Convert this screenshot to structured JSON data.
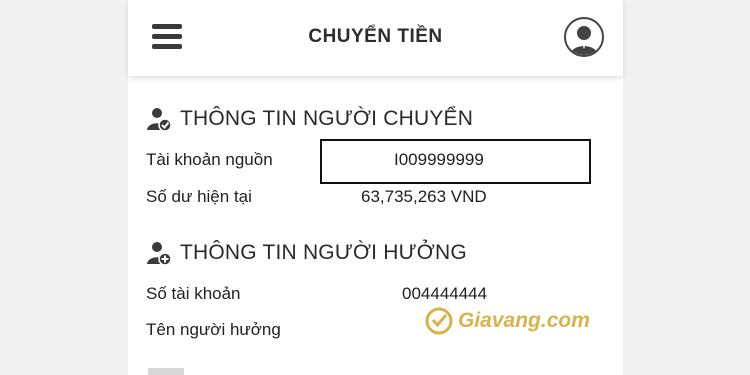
{
  "header": {
    "title": "CHUYỂN TIỀN",
    "menu_icon": "hamburger-menu-icon",
    "avatar_icon": "user-avatar-icon"
  },
  "sender_section": {
    "heading": "THÔNG TIN NGƯỜI CHUYỂN",
    "icon": "user-check-icon",
    "source_account_label": "Tài khoản nguồn",
    "source_account_value": "I009999999",
    "balance_label": "Số dư hiện tại",
    "balance_value": "63,735,263 VND"
  },
  "receiver_section": {
    "heading": "THÔNG TIN NGƯỜI HƯỞNG",
    "icon": "user-add-icon",
    "account_number_label": "Số tài khoản",
    "account_number_value": "004444444",
    "beneficiary_name_label": "Tên người hưởng",
    "beneficiary_name_value": ""
  },
  "watermark": {
    "text": "Giavang.com",
    "icon": "giavang-logo-icon"
  },
  "colors": {
    "watermark_gold": "#d8b24a",
    "text_dark": "#1f1f1f"
  }
}
